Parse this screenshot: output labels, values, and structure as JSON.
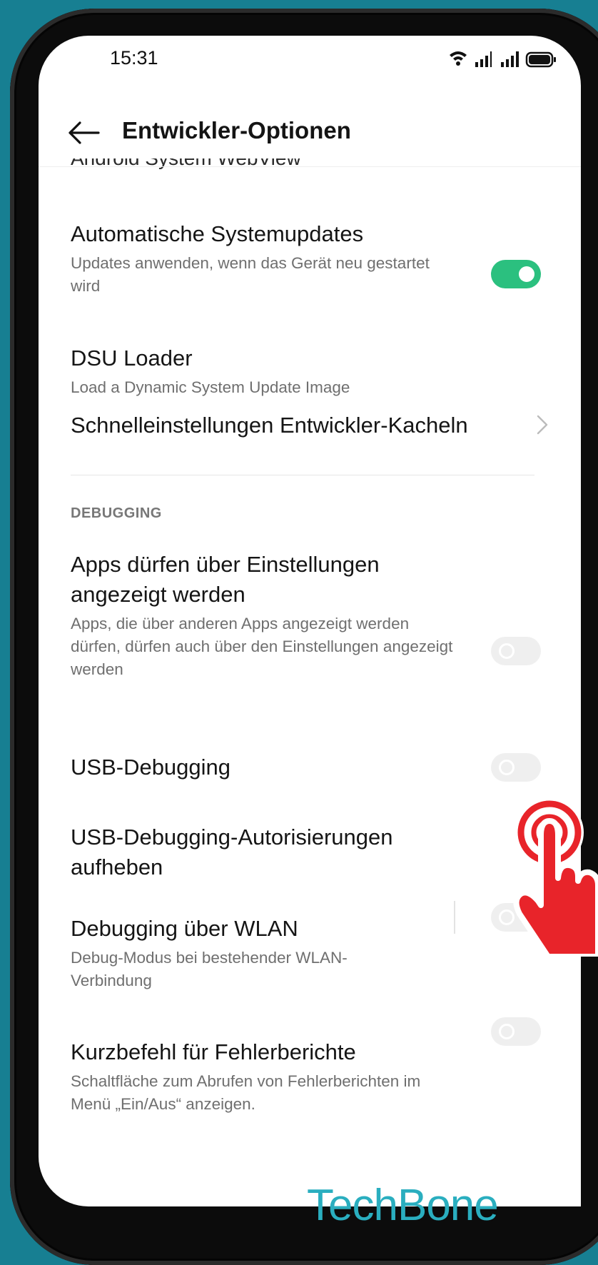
{
  "status_bar": {
    "time": "15:31"
  },
  "header": {
    "title": "Entwickler-Optionen"
  },
  "cut_off_item": "Android System WebView",
  "settings": {
    "auto_updates": {
      "title": "Automatische Systemupdates",
      "subtitle": "Updates anwenden, wenn das Gerät neu gestartet wird",
      "toggle": "on"
    },
    "dsu_loader": {
      "title": "DSU Loader",
      "subtitle": "Load a Dynamic System Update Image"
    },
    "quick_tiles": {
      "title": "Schnelleinstellungen Entwickler-Kacheln"
    },
    "section_debugging": "DEBUGGING",
    "overlay_settings": {
      "title": "Apps dürfen über Einstellungen angezeigt werden",
      "subtitle": "Apps, die über anderen Apps angezeigt werden dürfen, dürfen auch über den Einstellungen angezeigt werden",
      "toggle": "off"
    },
    "usb_debugging": {
      "title": "USB-Debugging",
      "toggle": "off"
    },
    "revoke_usb": {
      "title": "USB-Debugging-Autorisierungen aufheben"
    },
    "wlan_debugging": {
      "title": "Debugging über WLAN",
      "subtitle": "Debug-Modus bei bestehender WLAN-Verbindung",
      "toggle": "off"
    },
    "bugreport_shortcut": {
      "title": "Kurzbefehl für Fehlerberichte",
      "subtitle": "Schaltfläche zum Abrufen von Fehlerberichten im Menü „Ein/Aus“ anzeigen.",
      "toggle": "off"
    }
  },
  "watermark": "TechBone",
  "colors": {
    "background": "#177f92",
    "toggle_on": "#2bc07f",
    "pointer_hand": "#e8242a",
    "watermark": "#2aaebf"
  },
  "icons": [
    "back-arrow-icon",
    "wifi-icon",
    "signal-icon",
    "battery-icon",
    "chevron-right-icon",
    "pointer-hand-icon"
  ]
}
